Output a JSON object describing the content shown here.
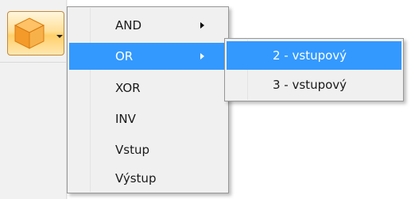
{
  "toolbar": {
    "gate_button_icon": "cube-icon",
    "dropdown_icon": "chevron-down-icon"
  },
  "menu": {
    "items": [
      {
        "label": "AND",
        "has_submenu": true
      },
      {
        "label": "OR",
        "has_submenu": true,
        "selected": true
      },
      {
        "label": "XOR"
      },
      {
        "label": "INV"
      },
      {
        "label": "Vstup"
      },
      {
        "label": "Výstup"
      }
    ]
  },
  "submenu": {
    "items": [
      {
        "label": "2 - vstupový",
        "selected": true
      },
      {
        "label": "3 - vstupový"
      }
    ]
  },
  "colors": {
    "highlight": "#3399ff",
    "menu_bg": "#f0f0f0",
    "cube_orange": "#f59a23"
  }
}
